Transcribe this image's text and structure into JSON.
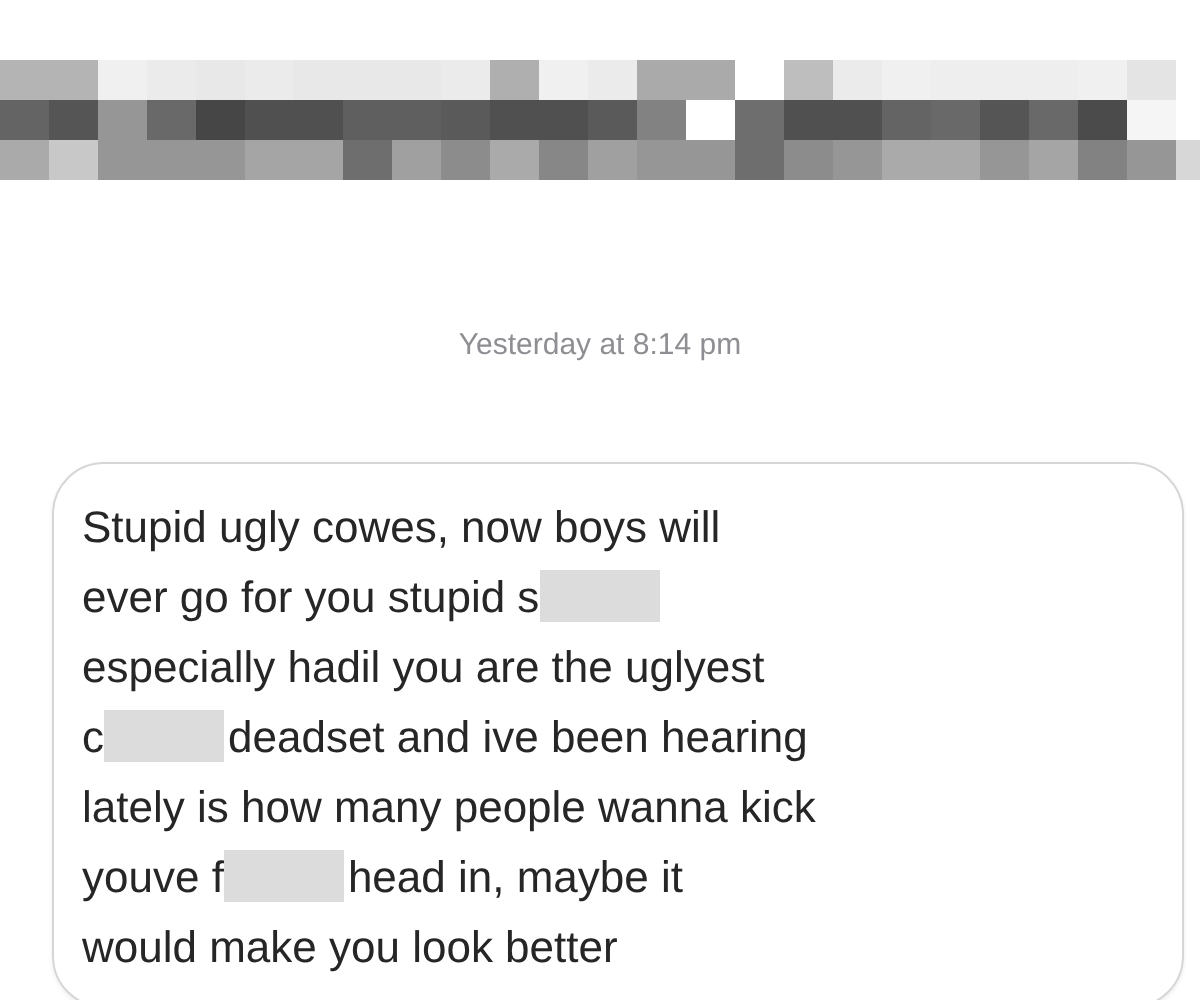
{
  "timestamp": "Yesterday at 8:14 pm",
  "message": {
    "lines": [
      [
        {
          "kind": "text",
          "text": "Stupid ugly cowes, now boys will"
        }
      ],
      [
        {
          "kind": "text",
          "text": "ever go for you stupid s"
        },
        {
          "kind": "redacted"
        }
      ],
      [
        {
          "kind": "text",
          "text": "especially hadil you are the uglyest"
        }
      ],
      [
        {
          "kind": "text",
          "text": "c"
        },
        {
          "kind": "redacted"
        },
        {
          "kind": "text",
          "text": "deadset and ive been hearing"
        }
      ],
      [
        {
          "kind": "text",
          "text": "lately is how many people wanna kick"
        }
      ],
      [
        {
          "kind": "text",
          "text": "youve f"
        },
        {
          "kind": "redacted"
        },
        {
          "kind": "text",
          "text": "head in, maybe it"
        }
      ],
      [
        {
          "kind": "text",
          "text": "would make you look better"
        }
      ]
    ]
  }
}
